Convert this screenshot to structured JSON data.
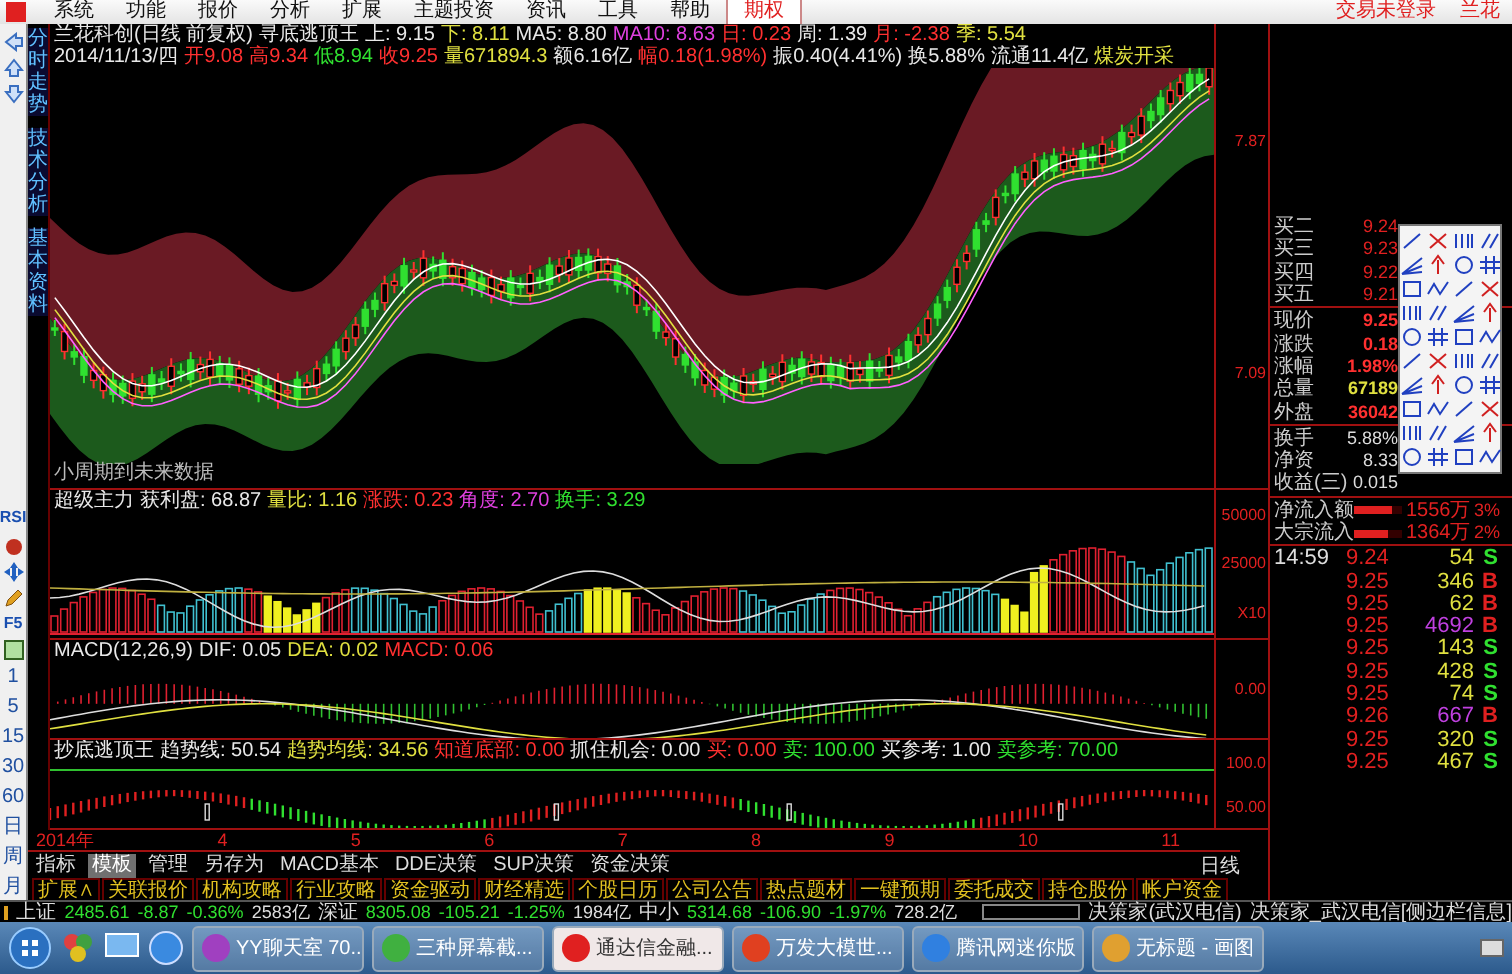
{
  "menu_bar": {
    "items": [
      "系统",
      "功能",
      "报价",
      "分析",
      "扩展",
      "主题投资",
      "资讯",
      "工具",
      "帮助"
    ],
    "option_tab": "期权",
    "login_status": "交易未登录",
    "product_name": "兰花"
  },
  "left_nav": {
    "tabs": [
      "分时走势",
      "技术分析",
      "基本资料"
    ],
    "tool_labels": [
      "RSI",
      "F5"
    ],
    "periods": [
      "1",
      "5",
      "15",
      "30",
      "60",
      "日",
      "周",
      "月"
    ]
  },
  "panes": [
    {
      "kind": "price",
      "lines": [
        [
          {
            "text": "兰花科创(日线 前复权)",
            "color": "#e8e8e8"
          },
          {
            "text": "寻底逃顶王",
            "color": "#e8e8e8"
          },
          {
            "text": "上: 9.15",
            "color": "#e8e8e8"
          },
          {
            "text": "下: 8.11",
            "color": "#e0e040"
          },
          {
            "text": "MA5: 8.80",
            "color": "#e8e8e8"
          },
          {
            "text": "MA10: 8.63",
            "color": "#e040e0"
          },
          {
            "text": "日: 0.23",
            "color": "#ff3030"
          },
          {
            "text": "周: 1.39",
            "color": "#e8e8e8"
          },
          {
            "text": "月: -2.38",
            "color": "#ff3030"
          },
          {
            "text": "季: 5.54",
            "color": "#e0e040"
          }
        ],
        [
          {
            "text": "2014/11/13/四",
            "color": "#e8e8e8"
          },
          {
            "text": "开9.08",
            "color": "#ff3030"
          },
          {
            "text": "高9.34",
            "color": "#ff3030"
          },
          {
            "text": "低8.94",
            "color": "#30e030"
          },
          {
            "text": "收9.25",
            "color": "#ff3030"
          },
          {
            "text": "量671894.3",
            "color": "#e0e040"
          },
          {
            "text": "额6.16亿",
            "color": "#e8e8e8"
          },
          {
            "text": "幅0.18(1.98%)",
            "color": "#ff3030"
          },
          {
            "text": "振0.40(4.41%)",
            "color": "#e8e8e8"
          },
          {
            "text": "换5.88%",
            "color": "#e8e8e8"
          },
          {
            "text": "流通11.4亿",
            "color": "#e8e8e8"
          },
          {
            "text": "煤炭开采",
            "color": "#e0e040"
          }
        ]
      ],
      "note": "小周期到未来数据",
      "axis_labels": [
        "7.87",
        "7.09"
      ]
    },
    {
      "kind": "volume",
      "lines": [
        [
          {
            "text": "超级主力",
            "color": "#e8e8e8"
          },
          {
            "text": "获利盘: 68.87",
            "color": "#e8e8e8"
          },
          {
            "text": "量比: 1.16",
            "color": "#e0e040"
          },
          {
            "text": "涨跌: 0.23",
            "color": "#ff3030"
          },
          {
            "text": "角度: 2.70",
            "color": "#e040e0"
          },
          {
            "text": "换手: 3.29",
            "color": "#30e030"
          }
        ]
      ],
      "axis_labels": [
        "50000",
        "25000",
        "X10"
      ]
    },
    {
      "kind": "macd",
      "lines": [
        [
          {
            "text": "MACD(12,26,9)",
            "color": "#e8e8e8"
          },
          {
            "text": "DIF: 0.05",
            "color": "#e8e8e8"
          },
          {
            "text": "DEA: 0.02",
            "color": "#e0e040"
          },
          {
            "text": "MACD: 0.06",
            "color": "#ff3030"
          }
        ]
      ],
      "axis_labels": [
        "0.00"
      ]
    },
    {
      "kind": "trend",
      "lines": [
        [
          {
            "text": "抄底逃顶王",
            "color": "#e8e8e8"
          },
          {
            "text": "趋势线: 50.54",
            "color": "#e8e8e8"
          },
          {
            "text": "趋势均线: 34.56",
            "color": "#e0e040"
          },
          {
            "text": "知道底部: 0.00",
            "color": "#ff3030"
          },
          {
            "text": "抓住机会: 0.00",
            "color": "#e8e8e8"
          },
          {
            "text": "买: 0.00",
            "color": "#ff3030"
          },
          {
            "text": "卖: 100.00",
            "color": "#30e030"
          },
          {
            "text": "买参考: 1.00",
            "color": "#e8e8e8"
          },
          {
            "text": "卖参考: 70.00",
            "color": "#30e030"
          }
        ]
      ],
      "axis_labels": [
        "100.0",
        "50.00"
      ]
    }
  ],
  "x_axis": {
    "labels": [
      "2014年",
      "4",
      "5",
      "6",
      "7",
      "8",
      "9",
      "10",
      "11"
    ],
    "period": "日线"
  },
  "template_tabs": [
    {
      "label": "指标",
      "selected": false
    },
    {
      "label": "模板",
      "selected": true
    },
    {
      "label": "管理",
      "selected": false
    },
    {
      "label": "另存为",
      "selected": false
    },
    {
      "label": "MACD基本",
      "selected": false
    },
    {
      "label": "DDE决策",
      "selected": false
    },
    {
      "label": "SUP决策",
      "selected": false
    },
    {
      "label": "资金决策",
      "selected": false
    }
  ],
  "extension_tabs": [
    "扩展∧",
    "关联报价",
    "机构攻略",
    "行业攻略",
    "资金驱动",
    "财经精选",
    "个股日历",
    "公司公告",
    "热点题材",
    "一键预期",
    "委托成交",
    "持仓股份",
    "帐户资金"
  ],
  "right_panel": {
    "order_book": [
      {
        "label": "买二",
        "price": "9.24"
      },
      {
        "label": "买三",
        "price": "9.23"
      },
      {
        "label": "买四",
        "price": "9.22"
      },
      {
        "label": "买五",
        "price": "9.21"
      }
    ],
    "quotes": [
      {
        "label": "现价",
        "value": "9.25",
        "color": "#ff3030"
      },
      {
        "label": "涨跌",
        "value": "0.18",
        "color": "#ff3030"
      },
      {
        "label": "涨幅",
        "value": "1.98%",
        "color": "#ff3030"
      },
      {
        "label": "总量",
        "value": "67189",
        "color": "#e0e040"
      },
      {
        "label": "外盘",
        "value": "36042",
        "color": "#ff3030"
      }
    ],
    "stats": [
      {
        "label": "换手",
        "value": "5.88%"
      },
      {
        "label": "净资",
        "value": "8.33"
      },
      {
        "label": "收益(三)",
        "value": "0.015"
      }
    ],
    "flows": [
      {
        "label": "净流入额",
        "value": "1556万",
        "share": "3%",
        "level": 0.8
      },
      {
        "label": "大宗流入",
        "value": "1364万",
        "share": "2%",
        "level": 0.7
      }
    ],
    "ticks": [
      {
        "time": "14:59",
        "price": "9.24",
        "volume": "54",
        "side": "S",
        "kind": "sell",
        "color": "#e0e040"
      },
      {
        "price": "9.25",
        "volume": "346",
        "side": "B",
        "kind": "buy",
        "color": "#e0e040"
      },
      {
        "price": "9.25",
        "volume": "62",
        "side": "B",
        "kind": "buy",
        "color": "#e0e040"
      },
      {
        "price": "9.25",
        "volume": "4692",
        "side": "B",
        "kind": "buy",
        "color": "#c040e0"
      },
      {
        "price": "9.25",
        "volume": "143",
        "side": "S",
        "kind": "sell",
        "color": "#e0e040"
      },
      {
        "price": "9.25",
        "volume": "428",
        "side": "S",
        "kind": "sell",
        "color": "#e0e040"
      },
      {
        "price": "9.25",
        "volume": "74",
        "side": "S",
        "kind": "sell",
        "color": "#e0e040"
      },
      {
        "price": "9.26",
        "volume": "667",
        "side": "B",
        "kind": "buy",
        "color": "#c040e0"
      },
      {
        "price": "9.25",
        "volume": "320",
        "side": "S",
        "kind": "sell",
        "color": "#e0e040"
      },
      {
        "price": "9.25",
        "volume": "467",
        "side": "S",
        "kind": "sell",
        "color": "#e0e040"
      }
    ]
  },
  "status_bar": {
    "indexes": [
      {
        "name": "上证",
        "value": "2485.61",
        "change": "-8.87",
        "percent": "-0.36%",
        "amount": "2583亿"
      },
      {
        "name": "深证",
        "value": "8305.08",
        "change": "-105.21",
        "percent": "-1.25%",
        "amount": "1984亿"
      },
      {
        "name": "中小",
        "value": "5314.68",
        "change": "-106.90",
        "percent": "-1.97%",
        "amount": "728.2亿"
      }
    ],
    "server": "决策家(武汉电信)",
    "info": "决策家_武汉电信[侧边栏信息]"
  },
  "taskbar": [
    {
      "label": "YY聊天室 70...",
      "selected": false
    },
    {
      "label": "三种屏幕截...",
      "selected": false
    },
    {
      "label": "通达信金融...",
      "selected": true
    },
    {
      "label": "万发大模世...",
      "selected": false
    },
    {
      "label": "腾讯网迷你版",
      "selected": false
    },
    {
      "label": "无标题 - 画图",
      "selected": false
    }
  ]
}
